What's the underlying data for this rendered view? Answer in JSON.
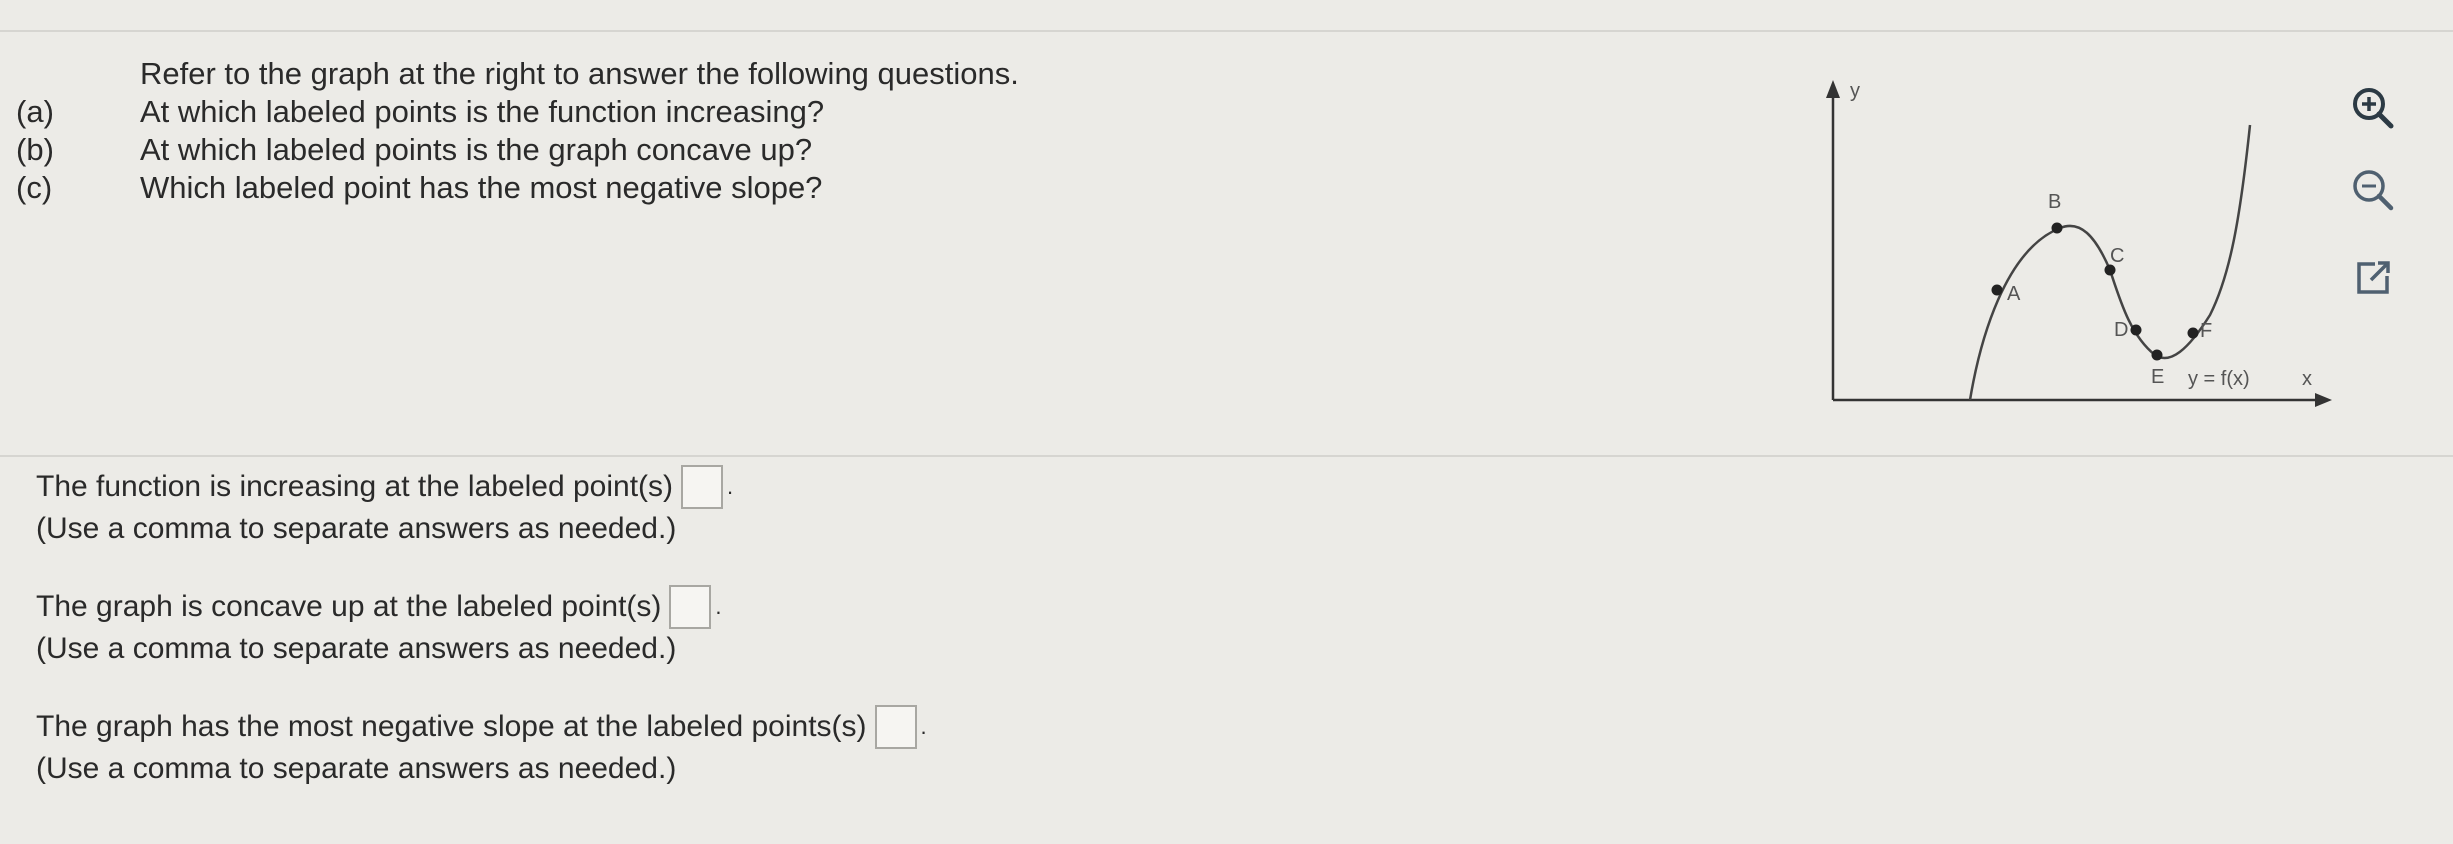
{
  "question": {
    "intro": "Refer to the graph at the right to answer the following questions.",
    "items": [
      {
        "label": "(a)",
        "text": "At which labeled points is the function increasing?"
      },
      {
        "label": "(b)",
        "text": "At which labeled points is the graph concave up?"
      },
      {
        "label": "(c)",
        "text": "Which labeled point has the most negative slope?"
      }
    ]
  },
  "graph": {
    "y_axis_label": "y",
    "x_axis_label": "x",
    "function_label": "y = f(x)",
    "points": [
      "A",
      "B",
      "C",
      "D",
      "E",
      "F"
    ]
  },
  "tools": {
    "zoom_in_icon": "zoom-in-icon",
    "zoom_out_icon": "zoom-out-icon",
    "popout_icon": "external-link-icon"
  },
  "answers": [
    {
      "prompt": "The function is increasing at the labeled point(s)",
      "value": "",
      "hint": "(Use a comma to separate answers as needed.)"
    },
    {
      "prompt": "The graph is concave up at the labeled point(s)",
      "value": "",
      "hint": "(Use a comma to separate answers as needed.)"
    },
    {
      "prompt": "The graph has the most negative slope at the labeled points(s)",
      "value": "",
      "hint": "(Use a comma to separate answers as needed.)"
    }
  ]
}
